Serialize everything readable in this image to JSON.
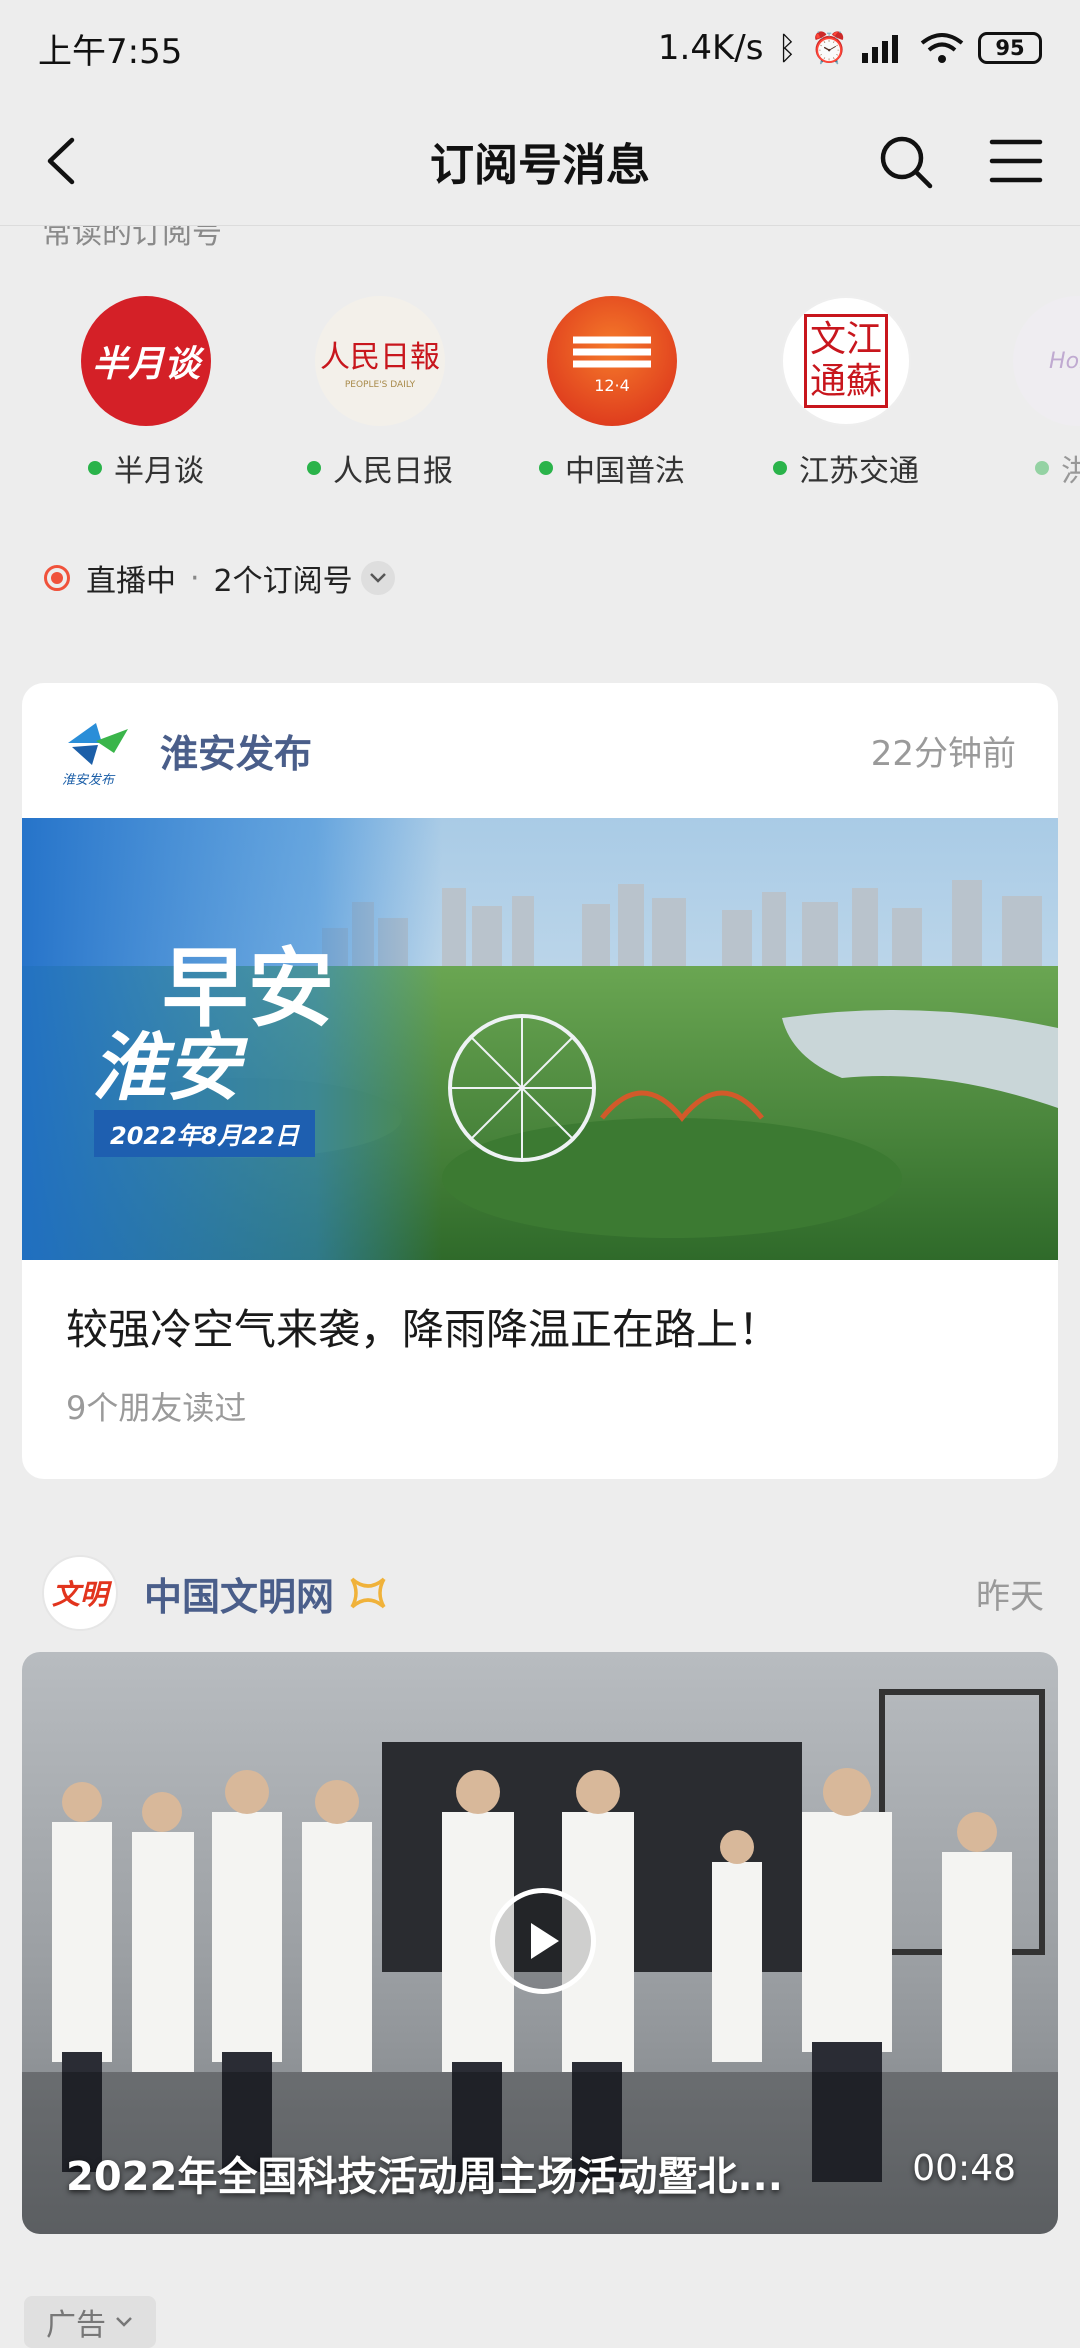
{
  "status": {
    "time": "上午7:55",
    "speed": "1.4K/s",
    "battery": "95"
  },
  "nav": {
    "title": "订阅号消息"
  },
  "frequent": {
    "label": "常读的订阅号",
    "accounts": [
      {
        "name": "半月谈",
        "logo_text": "半月谈"
      },
      {
        "name": "人民日报",
        "logo_text": "人民日報",
        "logo_sub": "PEOPLE'S DAILY"
      },
      {
        "name": "中国普法",
        "logo_text": "12·4"
      },
      {
        "name": "江苏交通",
        "logo_text": "文江通蘇"
      },
      {
        "name": "洪泽",
        "logo_text": "Hong"
      }
    ]
  },
  "live": {
    "label": "直播中",
    "count": "2个订阅号"
  },
  "card1": {
    "source": "淮安发布",
    "logo_text": "淮安发布",
    "time": "22分钟前",
    "banner": {
      "big1": "早安",
      "big2": "淮安",
      "date": "2022年8月22日"
    },
    "title": "较强冷空气来袭，降雨降温正在路上！",
    "meta": "9个朋友读过"
  },
  "card2": {
    "source": "中国文明网",
    "logo_text": "文明",
    "time": "昨天",
    "video_title": "2022年全国科技活动周主场活动暨北...",
    "duration": "00:48"
  },
  "ad": {
    "label": "广告"
  },
  "colors": {
    "accent_green": "#2ab34a",
    "live_red": "#f0523b",
    "source_blue": "#4a5e8a"
  }
}
